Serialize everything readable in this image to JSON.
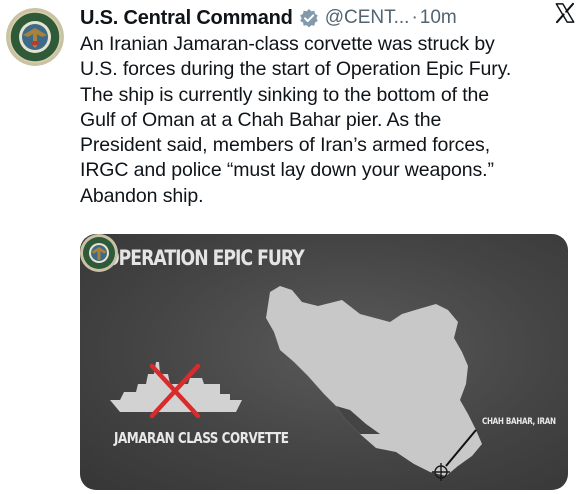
{
  "tweet": {
    "author_name": "U.S. Central Command",
    "handle": "@CENT...",
    "separator": "·",
    "time": "10m",
    "text_lines": [
      "An Iranian Jamaran-class corvette was struck by",
      "U.S. forces during the start of Operation Epic Fury.",
      "The ship is currently sinking to the bottom of the",
      "Gulf of Oman at a Chah Bahar pier. As the",
      "President said, members of Iran’s armed forces,",
      "IRGC and police “must lay down your weapons.”",
      "Abandon ship."
    ]
  },
  "media": {
    "title": "OPERATION EPIC FURY",
    "ship_label": "JAMARAN CLASS CORVETTE",
    "port_label": "CHAH BAHAR, IRAN"
  },
  "icons": {
    "avatar": "centcom-seal-icon",
    "verified": "verified-badge-icon",
    "platform": "x-logo-icon",
    "ship": "ship-silhouette-icon",
    "strike": "red-x-icon",
    "target": "crosshair-icon"
  },
  "colors": {
    "text": "#0f1419",
    "secondary": "#536471",
    "verified": "#829aab",
    "strike_red": "#d92b2b",
    "map_fill": "#c8c8c8"
  }
}
